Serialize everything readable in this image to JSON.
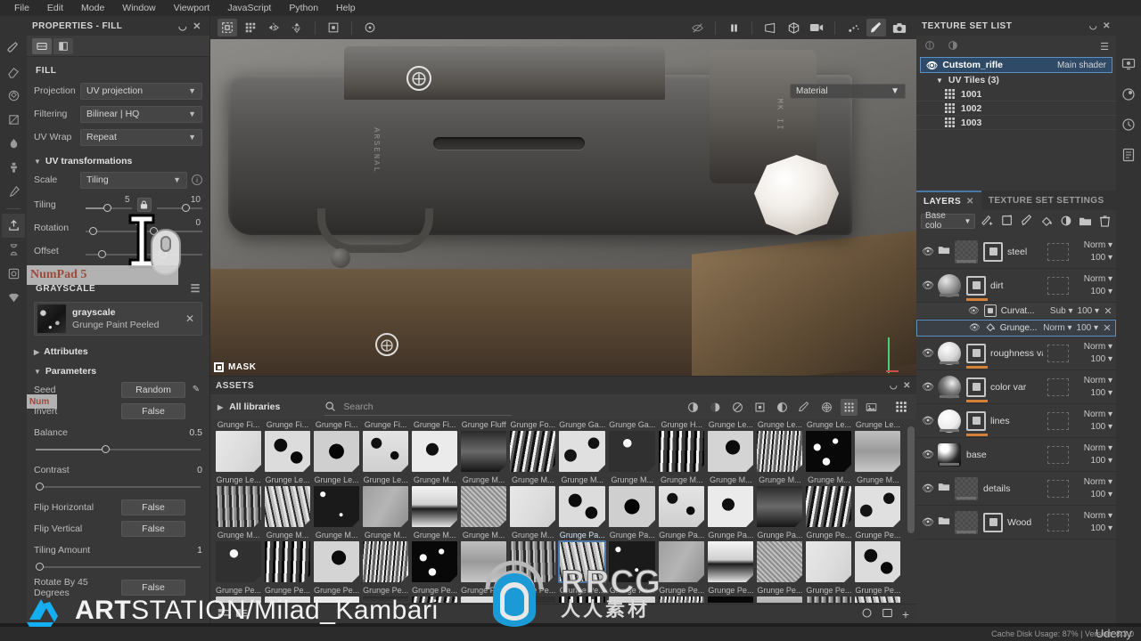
{
  "menubar": {
    "items": [
      "File",
      "Edit",
      "Mode",
      "Window",
      "Viewport",
      "JavaScript",
      "Python",
      "Help"
    ]
  },
  "properties": {
    "title": "PROPERTIES - FILL",
    "section_fill": "FILL",
    "fields": [
      {
        "label": "Projection",
        "value": "UV projection"
      },
      {
        "label": "Filtering",
        "value": "Bilinear | HQ"
      },
      {
        "label": "UV Wrap",
        "value": "Repeat"
      }
    ],
    "uv_transformations": {
      "header": "UV transformations",
      "scale_label": "Scale",
      "scale_value": "Tiling",
      "tiling_label": "Tiling",
      "tiling_value": "5",
      "tiling_max": "10",
      "rotation_label": "Rotation",
      "rotation_value": "0",
      "rotation_value2": "0",
      "offset_label": "Offset"
    },
    "grayscale": {
      "title": "GRAYSCALE",
      "name": "grayscale",
      "source": "Grunge Paint Peeled",
      "attributes": "Attributes",
      "parameters": "Parameters",
      "params": [
        {
          "label": "Seed",
          "value": "Random",
          "type": "button"
        },
        {
          "label": "Invert",
          "value": "False",
          "type": "button"
        },
        {
          "label": "Balance",
          "value": "0.5",
          "type": "slider"
        },
        {
          "label": "Contrast",
          "value": "0",
          "type": "slider"
        },
        {
          "label": "Flip Horizontal",
          "value": "False",
          "type": "button"
        },
        {
          "label": "Flip Vertical",
          "value": "False",
          "type": "button"
        },
        {
          "label": "Tiling Amount",
          "value": "1",
          "type": "slider"
        },
        {
          "label": "Rotate By 45 Degrees",
          "value": "False",
          "type": "button"
        }
      ]
    }
  },
  "viewport": {
    "material_dropdown": "Material",
    "mask_label": "MASK",
    "engraved_text_1": "ARSENAL",
    "engraved_text_2": "MK II"
  },
  "assets": {
    "title": "ASSETS",
    "library": "All libraries",
    "search_placeholder": "Search",
    "items": [
      "Grunge Fi...",
      "Grunge Fi...",
      "Grunge Fi...",
      "Grunge Fi...",
      "Grunge Fi...",
      "Grunge Fluff",
      "Grunge Fo...",
      "Grunge Ga...",
      "Grunge Ga...",
      "Grunge H...",
      "Grunge Le...",
      "Grunge Le...",
      "Grunge Le...",
      "Grunge Le...",
      "Grunge Le...",
      "Grunge Le...",
      "Grunge Le...",
      "Grunge Le...",
      "Grunge M...",
      "Grunge M...",
      "Grunge M...",
      "Grunge M...",
      "Grunge M...",
      "Grunge M...",
      "Grunge M...",
      "Grunge M...",
      "Grunge M...",
      "Grunge M...",
      "Grunge M...",
      "Grunge M...",
      "Grunge M...",
      "Grunge M...",
      "Grunge M...",
      "Grunge M...",
      "Grunge M...",
      "Grunge Pa...",
      "Grunge Pa...",
      "Grunge Pa...",
      "Grunge Pa...",
      "Grunge Pa...",
      "Grunge Pe...",
      "Grunge Pe...",
      "Grunge Pe...",
      "Grunge Pe...",
      "Grunge Pe...",
      "Grunge Pe...",
      "Grunge Pe...",
      "Grunge Pe...",
      "Grunge Pe...",
      "Grunge Pe...",
      "Grunge Pe...",
      "Grunge Pe...",
      "Grunge Pe...",
      "Grunge Pe...",
      "Grunge Pe...",
      "Grunge Pe..."
    ],
    "selected_index": 35
  },
  "texture_set_list": {
    "title": "TEXTURE SET LIST",
    "set_name": "Cutstom_rifle",
    "shader": "Main shader",
    "uv_tiles_label": "UV Tiles (3)",
    "tiles": [
      "1001",
      "1002",
      "1003"
    ]
  },
  "layers_panel": {
    "tab_layers": "LAYERS",
    "tab_settings": "TEXTURE SET SETTINGS",
    "channel": "Base colo",
    "layers": [
      {
        "name": "steel",
        "blend": "Norm",
        "opacity": "100",
        "thumb": "checker",
        "folder": true,
        "mask": true,
        "orange": false
      },
      {
        "name": "dirt",
        "blend": "Norm",
        "opacity": "100",
        "thumb": "sphere1",
        "folder": false,
        "mask": true,
        "orange": true,
        "children": [
          {
            "name": "Curvat...",
            "blend": "Sub",
            "opacity": "100",
            "icon": "mask-icon",
            "selected": false
          },
          {
            "name": "Grunge...",
            "blend": "Norm",
            "opacity": "100",
            "icon": "fill-icon",
            "selected": true
          }
        ]
      },
      {
        "name": "roughness var",
        "blend": "Norm",
        "opacity": "100",
        "thumb": "sphere2",
        "folder": false,
        "mask": true,
        "orange": true
      },
      {
        "name": "color var",
        "blend": "Norm",
        "opacity": "100",
        "thumb": "sphere3",
        "folder": false,
        "mask": true,
        "orange": true
      },
      {
        "name": "lines",
        "blend": "Norm",
        "opacity": "100",
        "thumb": "sphere4",
        "folder": false,
        "mask": true,
        "orange": true
      },
      {
        "name": "base",
        "blend": "Norm",
        "opacity": "100",
        "thumb": "sphere5",
        "folder": false,
        "mask": false,
        "orange": false
      },
      {
        "name": "details",
        "blend": "Norm",
        "opacity": "100",
        "thumb": "checker",
        "folder": true,
        "mask": false,
        "orange": false
      },
      {
        "name": "Wood",
        "blend": "Norm",
        "opacity": "100",
        "thumb": "checker",
        "folder": true,
        "mask": true,
        "orange": false
      }
    ]
  },
  "statusbar": {
    "text": "Cache Disk Usage:   87% | Version: 8.3.0"
  },
  "overlays": {
    "key_hint": "NumPad 5",
    "key_hint_small": "Num",
    "artstation": "ARTSTATION/Milad_Kambari",
    "artstation_bold": "ART",
    "artstation_rest": "STATION/Milad_Kambari",
    "rrcg_line1": "RRCG",
    "rrcg_line2": "人人素材",
    "udemy": "Udemy"
  },
  "colors": {
    "accent_blue": "#4a79a8",
    "orange_marker": "#d4813a",
    "panel_bg": "#383838",
    "header_bg": "#333333"
  }
}
